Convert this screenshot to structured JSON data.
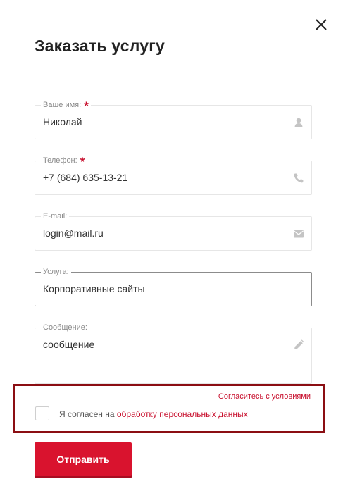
{
  "dialog": {
    "title": "Заказать услугу"
  },
  "fields": {
    "name": {
      "label": "Ваше имя:",
      "required_mark": "*",
      "value": "Николай",
      "icon": "user-icon"
    },
    "phone": {
      "label": "Телефон:",
      "required_mark": "*",
      "value": "+7 (684) 635-13-21",
      "icon": "phone-icon"
    },
    "email": {
      "label": "E-mail:",
      "value": "login@mail.ru",
      "icon": "envelope-icon"
    },
    "service": {
      "label": "Услуга:",
      "value": "Корпоративные сайты"
    },
    "message": {
      "label": "Сообщение:",
      "value": "сообщение",
      "icon": "pencil-icon"
    }
  },
  "consent": {
    "hint": "Согласитесь с условиями",
    "text_prefix": "Я согласен на ",
    "link_text": "обработку персональных данных",
    "checked": false
  },
  "submit": {
    "label": "Отправить"
  },
  "colors": {
    "accent": "#d9132e",
    "highlight_border": "#8b0e13",
    "label_gray": "#8a8a8a",
    "icon_gray": "#c4c4c4"
  }
}
